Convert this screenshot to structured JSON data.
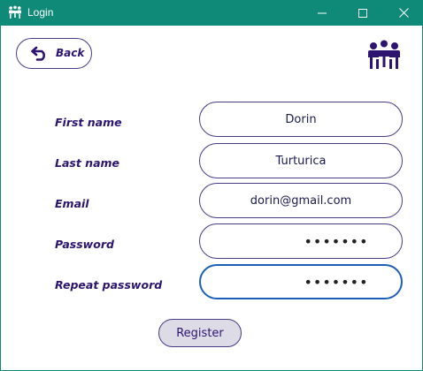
{
  "window": {
    "title": "Login",
    "title_bar_color": "#0f8a78"
  },
  "header": {
    "back_label": "Back",
    "back_icon": "undo-arrow-icon",
    "logo_icon": "team-meeting-icon"
  },
  "form": {
    "fields": [
      {
        "label": "First name",
        "value": "Dorin"
      },
      {
        "label": "Last name",
        "value": "Turturica"
      },
      {
        "label": "Email",
        "value": "dorin@gmail.com"
      },
      {
        "label": "Password",
        "value": "•••••••"
      },
      {
        "label": "Repeat password",
        "value": "•••••••"
      }
    ],
    "register_label": "Register"
  },
  "colors": {
    "accent": "#2d1470",
    "border": "#4a3a8a",
    "focus": "#1c5fb8",
    "button_fill": "#dcdbe6"
  }
}
